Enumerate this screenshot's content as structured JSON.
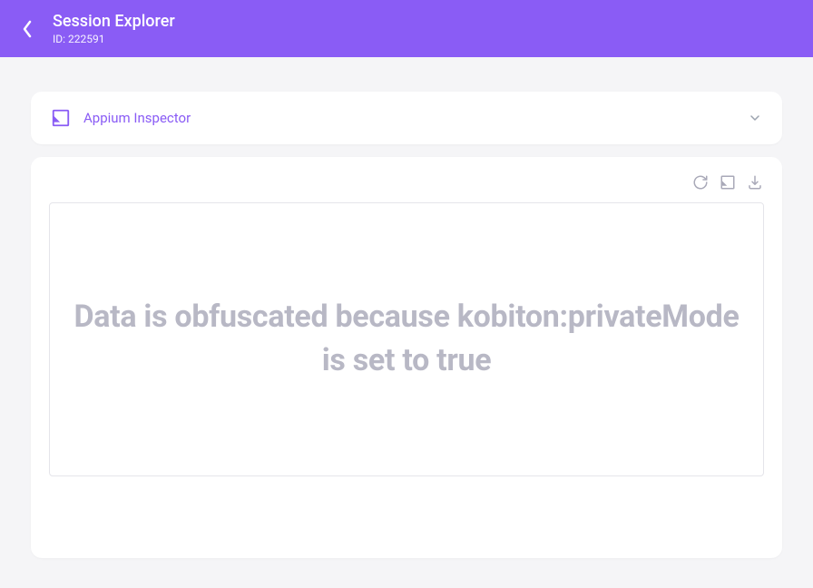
{
  "header": {
    "title": "Session Explorer",
    "id_label": "ID: 222591"
  },
  "inspector": {
    "label": "Appium Inspector"
  },
  "panel": {
    "message": "Data is obfuscated because kobiton:privateMode is set to true"
  }
}
